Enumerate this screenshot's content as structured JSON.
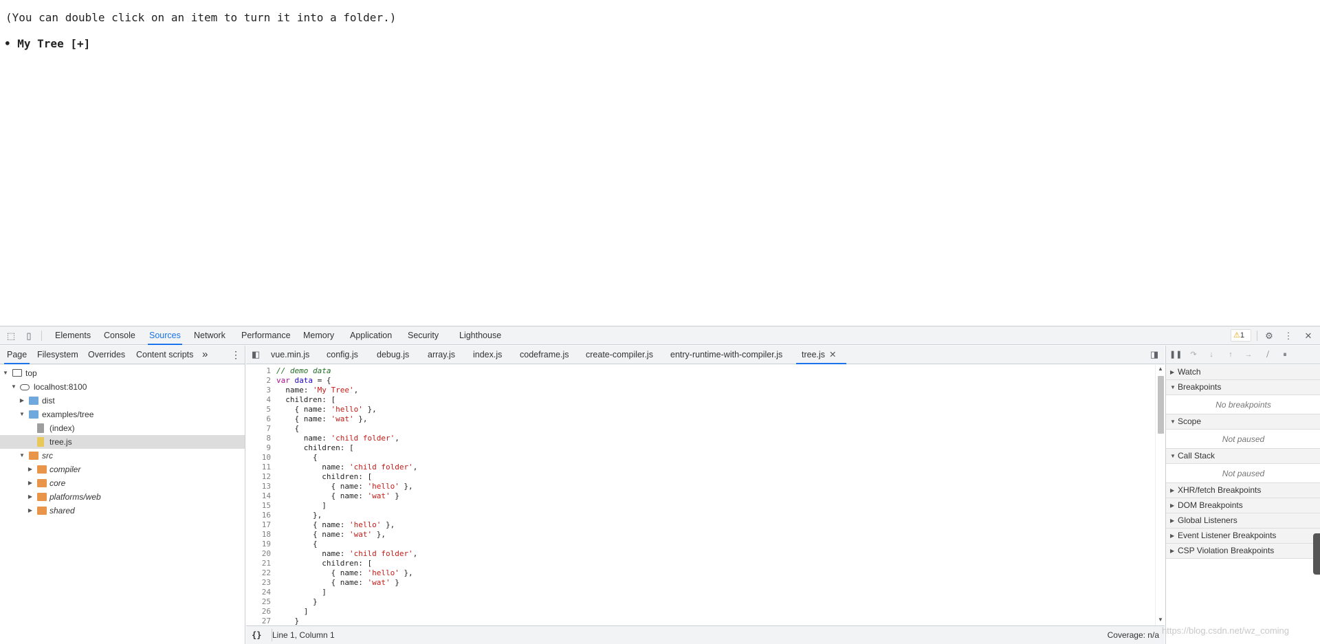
{
  "page": {
    "hint": "(You can double click on an item to turn it into a folder.)",
    "tree_root": "• My Tree [+]"
  },
  "devtools": {
    "main_tabs": [
      "Elements",
      "Console",
      "Sources",
      "Network",
      "Performance",
      "Memory",
      "Application",
      "Security",
      "Lighthouse"
    ],
    "active_main_tab": "Sources",
    "warning_count": "1",
    "navigator": {
      "tabs": [
        "Page",
        "Filesystem",
        "Overrides",
        "Content scripts"
      ],
      "more_label": "»",
      "active_tab": "Page",
      "tree": [
        {
          "label": "top",
          "icon": "frame-icon"
        },
        {
          "label": "localhost:8100",
          "icon": "cloud-icon"
        },
        {
          "label": "dist",
          "icon": "folder-icon"
        },
        {
          "label": "examples/tree",
          "icon": "folder-icon"
        },
        {
          "label": "(index)",
          "icon": "file-icon"
        },
        {
          "label": "tree.js",
          "icon": "file-icon",
          "selected": true
        },
        {
          "label": "src",
          "icon": "folder-icon"
        },
        {
          "label": "compiler",
          "icon": "folder-icon"
        },
        {
          "label": "core",
          "icon": "folder-icon"
        },
        {
          "label": "platforms/web",
          "icon": "folder-icon"
        },
        {
          "label": "shared",
          "icon": "folder-icon"
        }
      ]
    },
    "editor": {
      "file_tabs": [
        "vue.min.js",
        "config.js",
        "debug.js",
        "array.js",
        "index.js",
        "codeframe.js",
        "create-compiler.js",
        "entry-runtime-with-compiler.js",
        "tree.js"
      ],
      "active_file": "tree.js",
      "close_glyph": "✕",
      "line_numbers": [
        "1",
        "2",
        "3",
        "4",
        "5",
        "6",
        "7",
        "8",
        "9",
        "10",
        "11",
        "12",
        "13",
        "14",
        "15",
        "16",
        "17",
        "18",
        "19",
        "20",
        "21",
        "22",
        "23",
        "24",
        "25",
        "26",
        "27"
      ],
      "code_lines": [
        "// demo data",
        "var data = {",
        "  name: 'My Tree',",
        "  children: [",
        "    { name: 'hello' },",
        "    { name: 'wat' },",
        "    {",
        "      name: 'child folder',",
        "      children: [",
        "        {",
        "          name: 'child folder',",
        "          children: [",
        "            { name: 'hello' },",
        "            { name: 'wat' }",
        "          ]",
        "        },",
        "        { name: 'hello' },",
        "        { name: 'wat' },",
        "        {",
        "          name: 'child folder',",
        "          children: [",
        "            { name: 'hello' },",
        "            { name: 'wat' }",
        "          ]",
        "        }",
        "      ]",
        "    }"
      ],
      "status": {
        "format_glyph": "{}",
        "position": "Line 1, Column 1",
        "coverage": "Coverage: n/a"
      }
    },
    "debugger": {
      "sections": {
        "watch": "Watch",
        "breakpoints": "Breakpoints",
        "breakpoints_empty": "No breakpoints",
        "scope": "Scope",
        "scope_empty": "Not paused",
        "call_stack": "Call Stack",
        "call_stack_empty": "Not paused",
        "xhr": "XHR/fetch Breakpoints",
        "dom": "DOM Breakpoints",
        "global": "Global Listeners",
        "event": "Event Listener Breakpoints",
        "csp": "CSP Violation Breakpoints"
      }
    }
  },
  "watermark": "https://blog.csdn.net/wz_coming",
  "colors": {
    "accent": "#1a73e8",
    "folder_blue": "#6fa8dc",
    "folder_orange": "#e8954a",
    "warning": "#e8a100"
  }
}
